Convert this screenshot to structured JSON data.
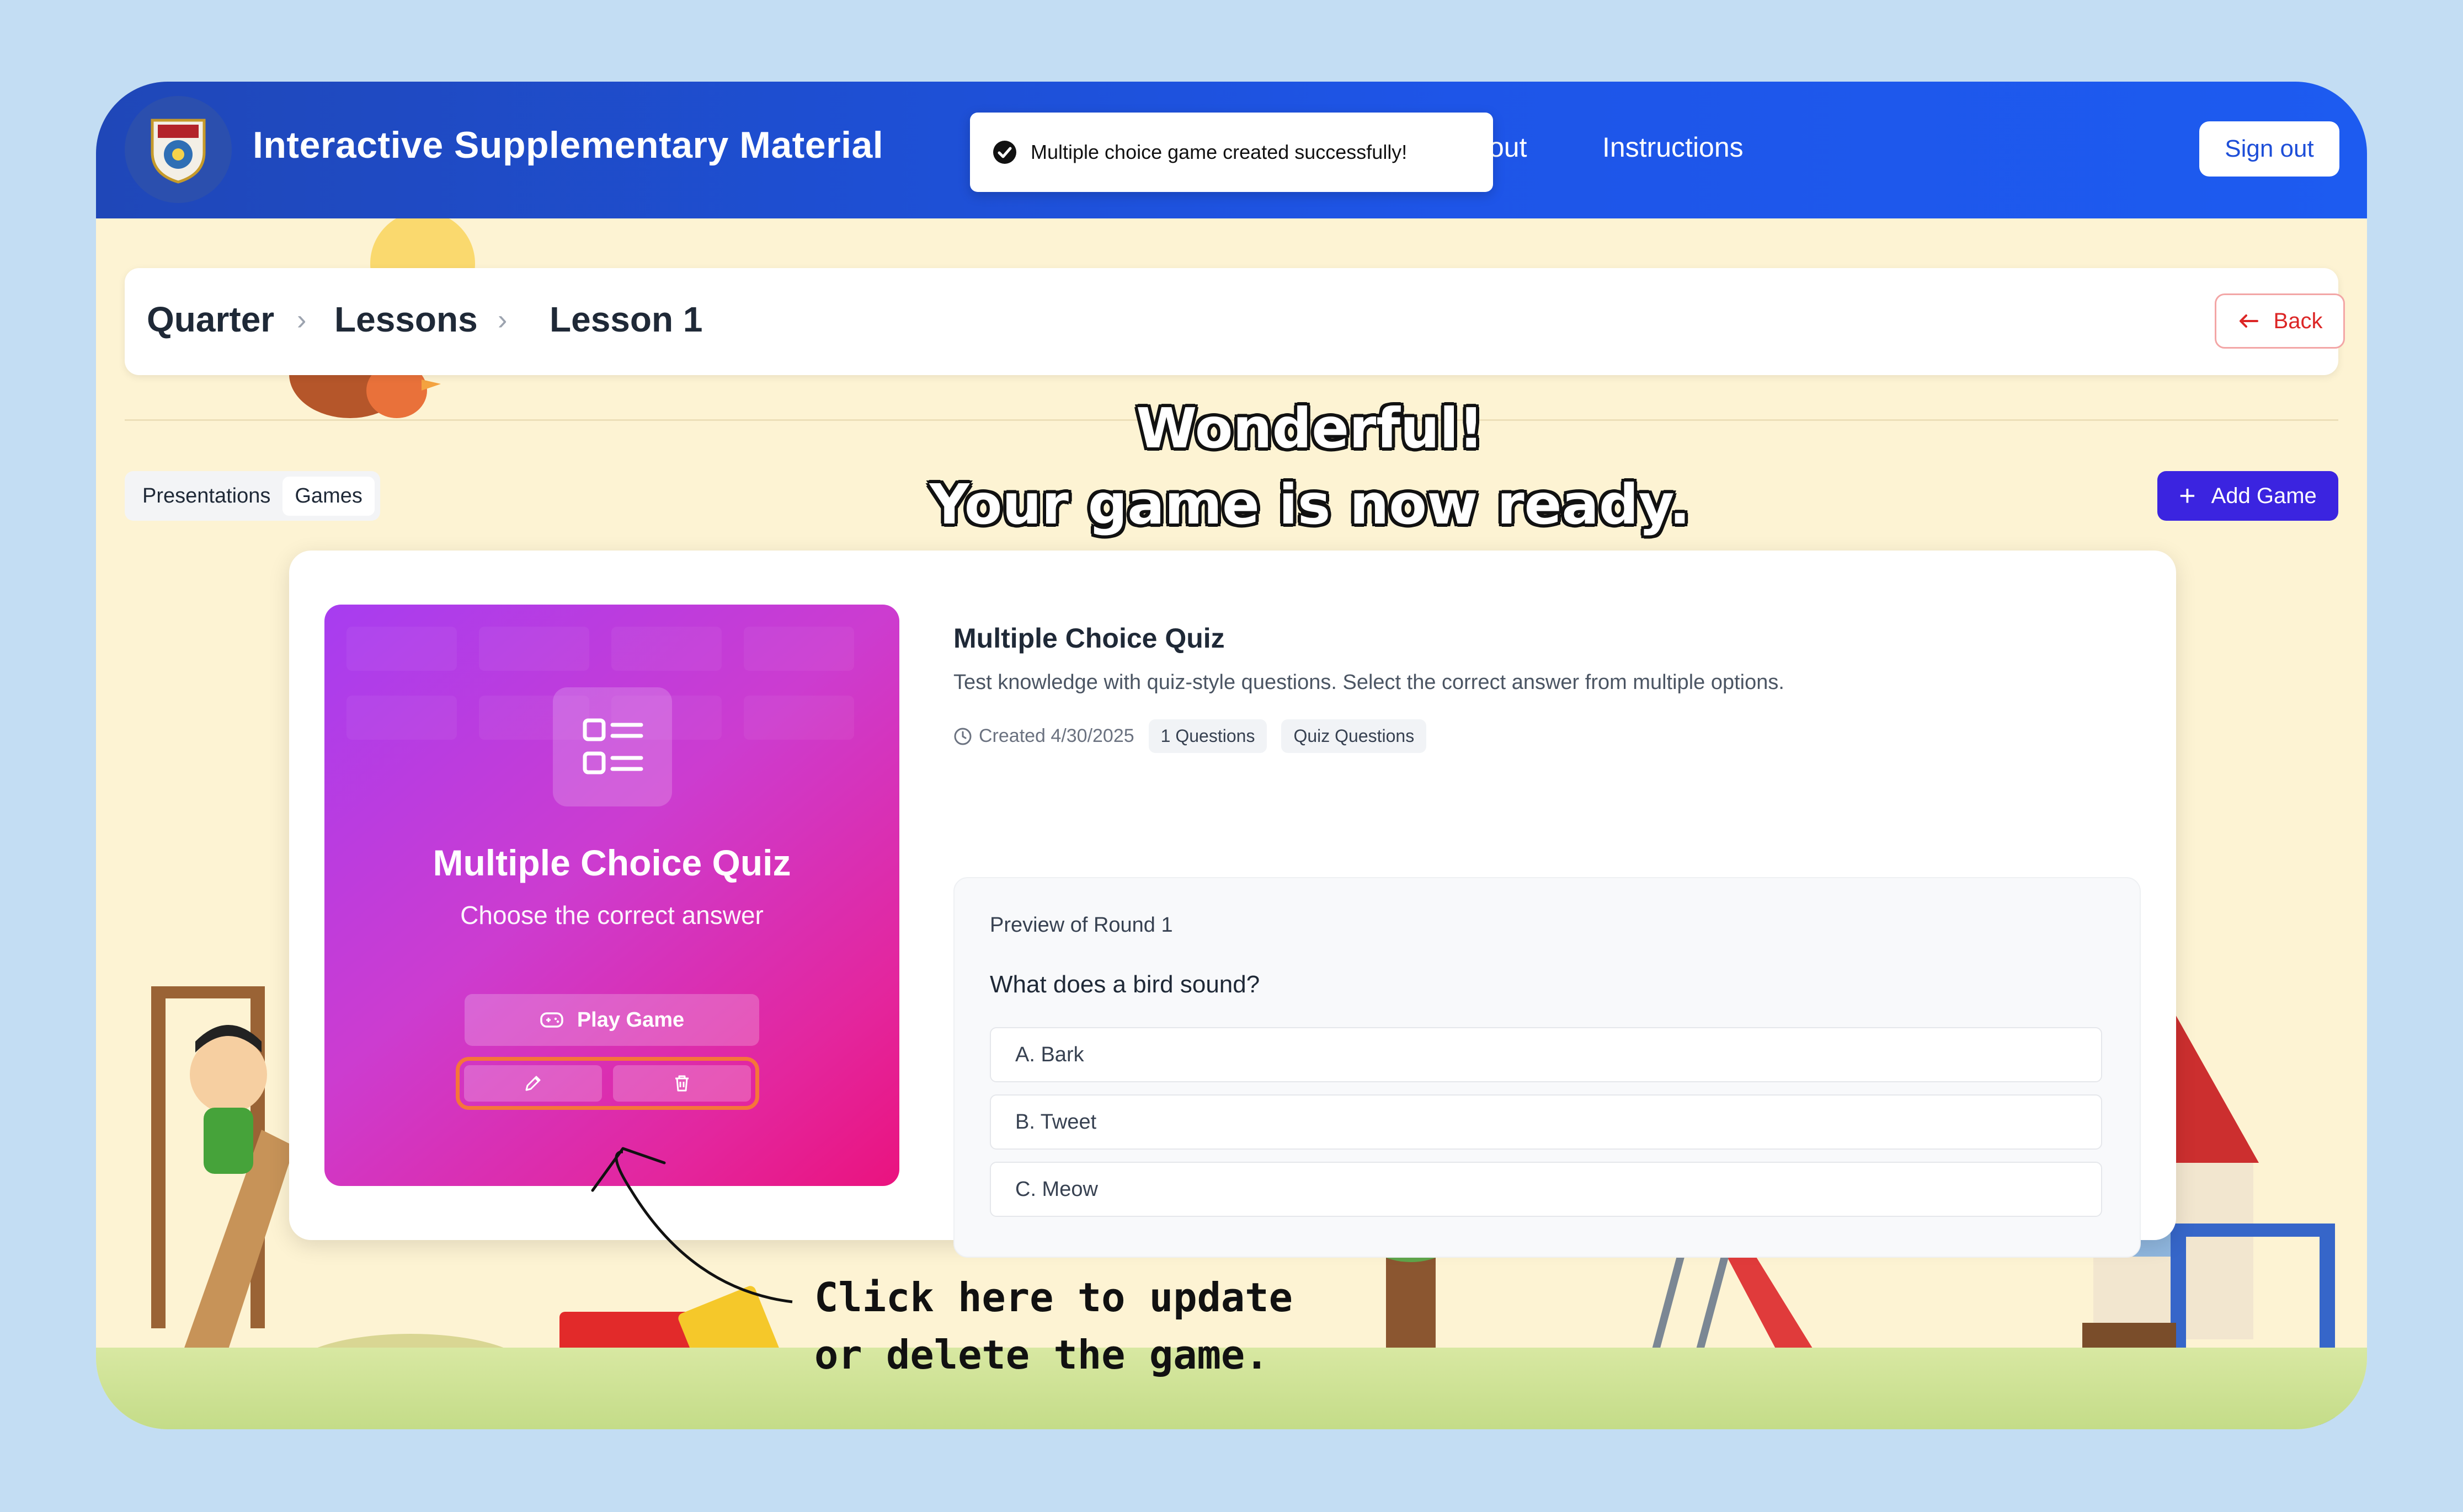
{
  "header": {
    "app_title": "Interactive Supplementary Material",
    "nav": [
      "out",
      "Instructions"
    ],
    "sign_out": "Sign out"
  },
  "toast": {
    "message": "Multiple choice game created successfully!"
  },
  "breadcrumb": {
    "items": [
      "Quarter",
      "Lessons",
      "Lesson 1"
    ],
    "back_label": "Back"
  },
  "tabs": {
    "items": [
      "Presentations",
      "Games"
    ],
    "active": "Games"
  },
  "add_game_label": "Add Game",
  "overlay": {
    "line1": "Wonderful!",
    "line2": "Your game is now ready."
  },
  "game_card": {
    "tile": {
      "title": "Multiple Choice Quiz",
      "subtitle": "Choose the correct answer",
      "play_label": "Play Game"
    },
    "title": "Multiple Choice Quiz",
    "description": "Test knowledge with quiz-style questions. Select the correct answer from multiple options.",
    "created": "Created 4/30/2025",
    "chips": [
      "1 Questions",
      "Quiz Questions"
    ],
    "preview": {
      "label": "Preview of Round 1",
      "question": "What does a bird sound?",
      "options": [
        "A. Bark",
        "B. Tweet",
        "C. Meow"
      ]
    }
  },
  "hint": {
    "line1": "Click here to update",
    "line2": "or delete the game."
  },
  "colors": {
    "header": "#1e55e8",
    "accent": "#3b24e0",
    "tile_start": "#a73df0",
    "tile_end": "#ea137f",
    "highlight": "#f6753a",
    "back": "#dc2626"
  }
}
